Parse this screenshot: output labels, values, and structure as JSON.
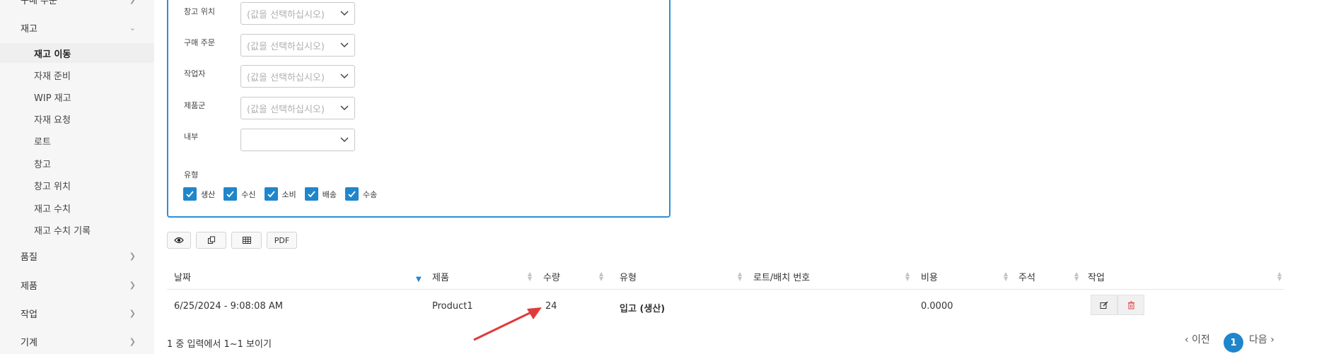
{
  "sidebar": {
    "top_partial": "구매 주문",
    "inventory": {
      "label": "재고",
      "items": [
        {
          "label": "재고 이동",
          "active": true
        },
        {
          "label": "자재 준비"
        },
        {
          "label": "WIP 재고"
        },
        {
          "label": "자재 요청"
        },
        {
          "label": "로트"
        },
        {
          "label": "창고"
        },
        {
          "label": "창고 위치"
        },
        {
          "label": "재고 수치"
        },
        {
          "label": "재고 수치 기록"
        }
      ]
    },
    "categories": [
      "품질",
      "제품",
      "작업",
      "기계"
    ]
  },
  "filters": {
    "fields": [
      {
        "label": "창고 위치",
        "placeholder": "(값을 선택하십시오)"
      },
      {
        "label": "구매 주문",
        "placeholder": "(값을 선택하십시오)"
      },
      {
        "label": "작업자",
        "placeholder": "(값을 선택하십시오)"
      },
      {
        "label": "제품군",
        "placeholder": "(값을 선택하십시오)"
      },
      {
        "label": "내부",
        "placeholder": ""
      }
    ],
    "type_label": "유형",
    "types": [
      {
        "label": "생산",
        "checked": true
      },
      {
        "label": "수신",
        "checked": true
      },
      {
        "label": "소비",
        "checked": true
      },
      {
        "label": "배송",
        "checked": true
      },
      {
        "label": "수송",
        "checked": true
      }
    ]
  },
  "toolbar": {
    "view_icon": "eye-icon",
    "copy_icon": "copy-icon",
    "excel_icon": "table-icon",
    "pdf_label": "PDF"
  },
  "table": {
    "columns": [
      "날짜",
      "제품",
      "수량",
      "유형",
      "로트/배치 번호",
      "비용",
      "주석",
      "작업"
    ],
    "rows": [
      {
        "date": "6/25/2024 - 9:08:08 AM",
        "product": "Product1",
        "quantity": "24",
        "type": "입고 (생산)",
        "lot": "",
        "cost": "0.0000",
        "note": ""
      }
    ]
  },
  "footer": {
    "info": "1 중 입력에서 1~1 보이기",
    "prev": "‹ 이전",
    "current_page": "1",
    "next": "다음 ›"
  },
  "colors": {
    "accent": "#1f86cc",
    "panel_border": "#2b8fd6",
    "delete": "#e05050",
    "annotation_arrow": "#e03a3a"
  }
}
